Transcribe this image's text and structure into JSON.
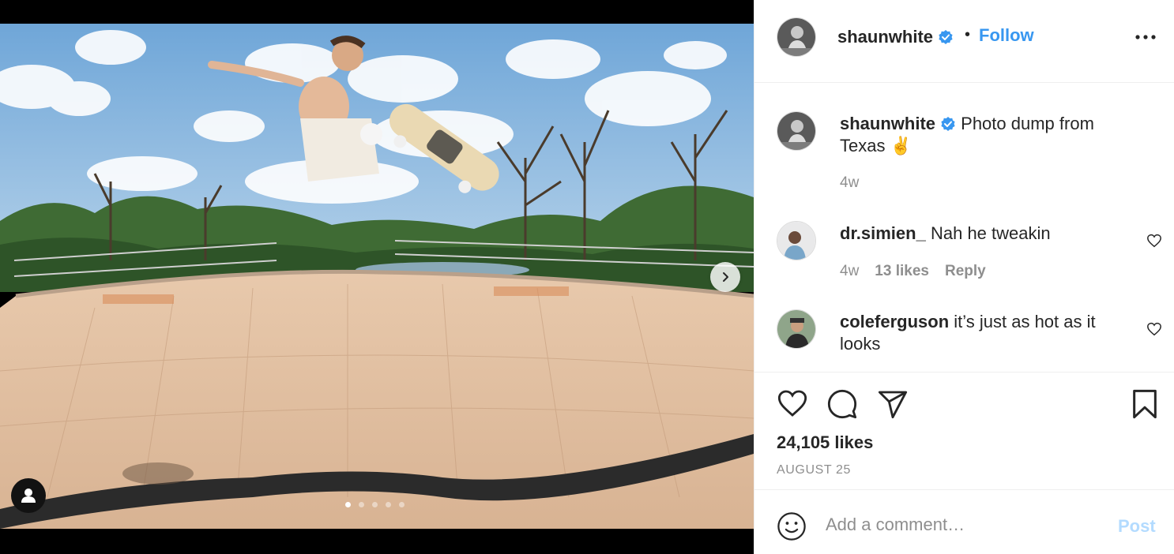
{
  "post": {
    "author": "shaunwhite",
    "follow_label": "Follow",
    "separator": "•",
    "caption": "Photo dump from Texas ✌️",
    "caption_age": "4w",
    "likes": "24,105 likes",
    "date": "AUGUST 25",
    "carousel_slides": 5,
    "carousel_active": 1
  },
  "comments": [
    {
      "user": "dr.simien_",
      "text": "Nah he tweakin",
      "age": "4w",
      "likes": "13 likes",
      "reply_label": "Reply"
    },
    {
      "user": "coleferguson",
      "text": "it’s just as hot as it looks"
    }
  ],
  "composer": {
    "placeholder": "Add a comment…",
    "post_label": "Post"
  },
  "colors": {
    "link": "#3897f0",
    "muted": "#8e8e8e",
    "post_disabled": "#b3dbff",
    "verified": "#3897f0"
  },
  "icons": [
    "verified-badge-icon",
    "more-options-icon",
    "heart-icon",
    "comment-icon",
    "share-icon",
    "bookmark-icon",
    "emoji-icon",
    "chevron-right-icon",
    "user-tag-icon"
  ]
}
